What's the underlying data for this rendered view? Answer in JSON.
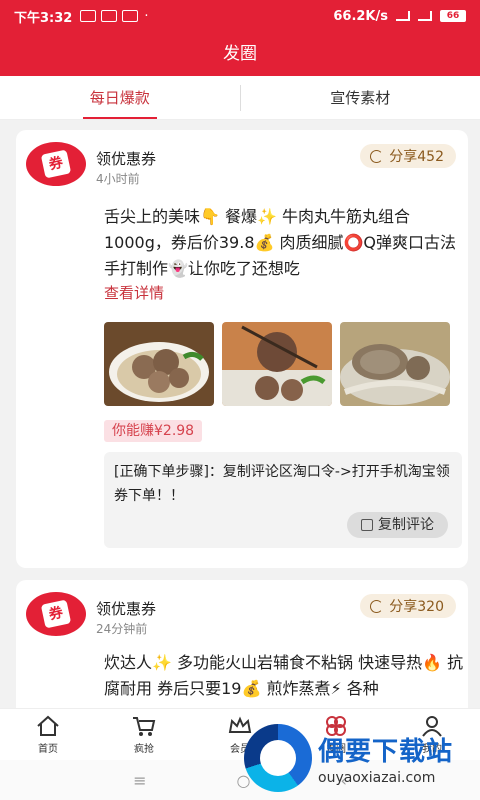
{
  "status": {
    "time": "下午3:32",
    "speed": "66.2K/s",
    "battery": "66"
  },
  "header": {
    "title": "发圈"
  },
  "tabs": [
    {
      "label": "每日爆款"
    },
    {
      "label": "宣传素材"
    }
  ],
  "posts": [
    {
      "author": "领优惠券",
      "logo_char": "券",
      "time": "4小时前",
      "share": "分享452",
      "text": "舌尖上的美味👇 餐爆✨ 牛肉丸牛筋丸组合1000g，券后价39.8💰 肉质细腻⭕Q弹爽口古法手打制作👻让你吃了还想吃",
      "detail": "查看详情",
      "earn": "你能赚¥2.98",
      "steps": "[正确下单步骤]：复制评论区淘口令->打开手机淘宝领券下单！！",
      "copy": "复制评论"
    },
    {
      "author": "领优惠券",
      "logo_char": "券",
      "time": "24分钟前",
      "share": "分享320",
      "text": "炊达人✨ 多功能火山岩辅食不粘锅 快速导热🔥 抗腐耐用 券后只要19💰 煎炸蒸煮⚡ 各种"
    }
  ],
  "nav": [
    {
      "label": "首页",
      "icon": "home-icon"
    },
    {
      "label": "疯抢",
      "icon": "cart-icon"
    },
    {
      "label": "会员",
      "icon": "crown-icon"
    },
    {
      "label": "发圈",
      "icon": "flower-icon"
    },
    {
      "label": "我的",
      "icon": "user-icon"
    }
  ],
  "system_nav": {
    "menu": "≡",
    "home": "○",
    "back": "‹"
  },
  "watermark": {
    "cn": "偶要下载站",
    "en": "ouyaoxiazai.com"
  },
  "colors": {
    "brand": "#e32036",
    "share_bg": "#f7eee0",
    "earn_bg": "#fbe0e4"
  }
}
